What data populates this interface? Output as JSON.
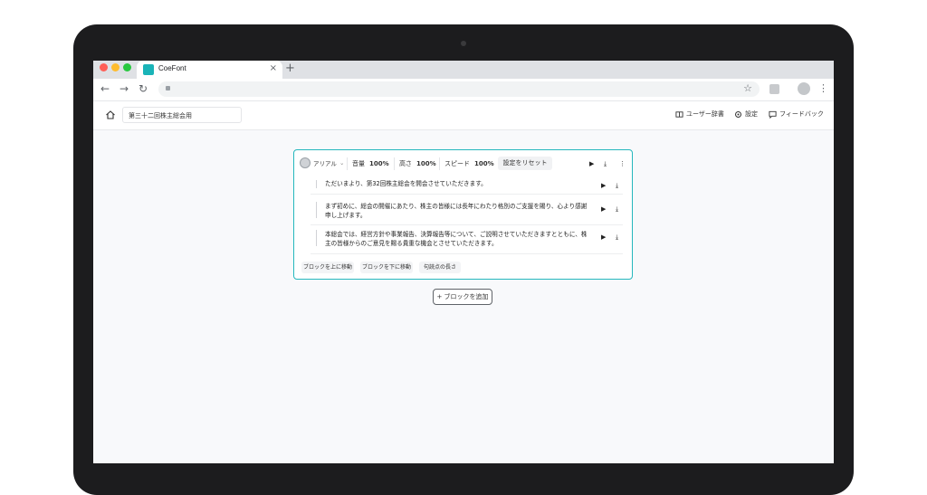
{
  "browser": {
    "tab_title": "CoeFont",
    "tab_close": "×",
    "new_tab": "+",
    "back": "←",
    "forward": "→",
    "reload": "↻",
    "star": "☆",
    "menu": "⋮",
    "traffic_colors": [
      "#ff5f57",
      "#febc2e",
      "#28c840"
    ],
    "accent": "#1ab4b8"
  },
  "app": {
    "project_name": "第三十二回株主総会用",
    "header_items": [
      {
        "label": "ユーザー辞書",
        "icon": "dictionary-icon"
      },
      {
        "label": "設定",
        "icon": "gear-icon"
      },
      {
        "label": "フィードバック",
        "icon": "feedback-icon"
      }
    ]
  },
  "editor": {
    "voice_name": "アリアル",
    "voice_caret": "⌄",
    "params": [
      {
        "label": "音量",
        "value": "100%"
      },
      {
        "label": "高さ",
        "value": "100%"
      },
      {
        "label": "スピード",
        "value": "100%"
      }
    ],
    "reset_label": "設定をリセット",
    "play_icon": "▶",
    "download_icon": "⤓",
    "more_icon": "⋮",
    "blocks": [
      {
        "text": "ただいまより、第32回株主総会を開会させていただきます。"
      },
      {
        "text": "まず初めに、総会の開催にあたり、株主の皆様には長年にわたり格別のご支援を賜り、心より感謝申し上げます。",
        "lines": [
          "まず初めに、総会の開催にあたり、株主の皆様には長年にわたり格別のご支援を賜り、心より感謝",
          "申し上げます。"
        ]
      },
      {
        "text": "本総会では、経営方針や事業報告、決算報告等について、ご説明させていただきますとともに、株主の皆様からのご意見を賜る貴重な機会とさせていただきます。",
        "lines": [
          "本総会では、経営方針や事業報告、決算報告等について、ご説明させていただきますとともに、株",
          "主の皆様からのご意見を賜る貴重な機会とさせていただきます。"
        ]
      }
    ],
    "actions": [
      "ブロックを上に移動",
      "ブロックを下に移動",
      "句読点の長さ"
    ],
    "add_block_label": "+ ブロックを追加"
  }
}
